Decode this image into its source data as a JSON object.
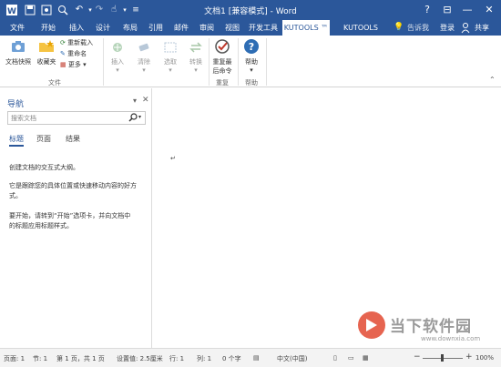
{
  "title_bar": {
    "document_title": "文档1 [兼容模式] - Word",
    "window_buttons": [
      "?",
      "⊟",
      "—",
      "☐",
      "✕"
    ]
  },
  "tabs": [
    {
      "label": "文件"
    },
    {
      "label": "开始"
    },
    {
      "label": "插入"
    },
    {
      "label": "设计"
    },
    {
      "label": "布局"
    },
    {
      "label": "引用"
    },
    {
      "label": "邮件"
    },
    {
      "label": "审阅"
    },
    {
      "label": "视图"
    },
    {
      "label": "开发工具"
    },
    {
      "label": "KUTOOLS ™"
    },
    {
      "label": "KUTOOLS PLUS"
    }
  ],
  "tell_me": "告诉我",
  "login": "登录",
  "share": "共享",
  "ribbon": {
    "snapshot": "文档快照",
    "favorites": "收藏夹",
    "reload": "重新载入",
    "rename": "重命名",
    "more": "更多",
    "group_file": "文件",
    "insert": "插入",
    "clear": "清除",
    "select": "选取",
    "convert": "转换",
    "repeat_line1": "重复最",
    "repeat_line2": "后命令",
    "group_repeat": "重复",
    "help": "帮助",
    "group_help": "帮助"
  },
  "nav": {
    "title": "导航",
    "search_placeholder": "搜索文档",
    "tabs": [
      "标题",
      "页面",
      "结果"
    ],
    "msg1": "创建文档的交互式大纲。",
    "msg2_line1": "它是跟踪您的具体位置或快速移动内容的好方",
    "msg2_line2": "式。",
    "msg3_line1": "要开始，请转到“开始”选项卡，并向文档中",
    "msg3_line2": "的标题应用标题样式。"
  },
  "status": {
    "page": "页面: 1",
    "section": "节: 1",
    "page_of": "第 1 页，共 1 页",
    "position": "设置值: 2.5厘米",
    "line": "行: 1",
    "column": "列: 1",
    "chars": "0 个字",
    "language": "中文(中国)",
    "zoom": "100%"
  },
  "watermark": {
    "brand": "当下软件园",
    "url": "www.downxia.com"
  },
  "colors": {
    "word_blue": "#2b579a",
    "help_blue": "#2e6db4",
    "folder_yellow": "#f5c342",
    "repeat_red": "#c0392b"
  }
}
